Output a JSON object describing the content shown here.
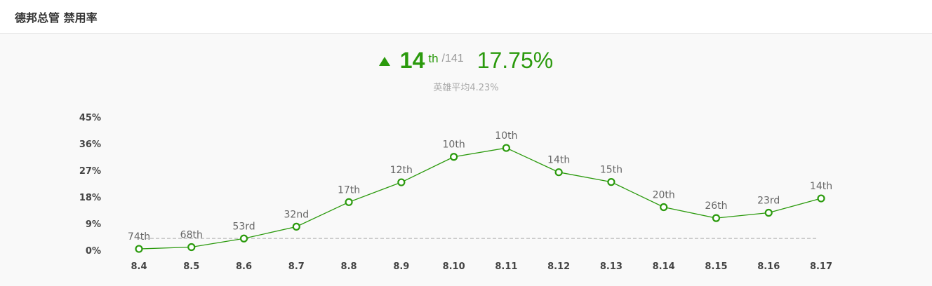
{
  "page": {
    "title": "德邦总管 禁用率"
  },
  "summary": {
    "trend": "up",
    "rank": "14",
    "rank_suffix": "th",
    "rank_total": "/141",
    "rate": "17.75%",
    "average_label": "英雄平均4.23%"
  },
  "colors": {
    "accent": "#2b9a0d",
    "average_line": "#aaaaaa",
    "text": "#444444"
  },
  "icons": {
    "trend_icon": "triangle-up-icon"
  },
  "chart_data": {
    "type": "line",
    "title": "德邦总管 禁用率",
    "xlabel": "",
    "ylabel": "",
    "categories": [
      "8.4",
      "8.5",
      "8.6",
      "8.7",
      "8.8",
      "8.9",
      "8.10",
      "8.11",
      "8.12",
      "8.13",
      "8.14",
      "8.15",
      "8.16",
      "8.17"
    ],
    "ylim": [
      0,
      45
    ],
    "yticks": [
      "0%",
      "9%",
      "18%",
      "27%",
      "36%",
      "45%"
    ],
    "ytick_values": [
      0,
      9,
      18,
      27,
      36,
      45
    ],
    "series": [
      {
        "values": [
          0.7,
          1.3,
          4.2,
          8.2,
          16.5,
          23.2,
          31.8,
          34.8,
          26.6,
          23.3,
          14.8,
          11.1,
          12.9,
          17.75
        ],
        "point_labels": [
          "74th",
          "68th",
          "53rd",
          "32nd",
          "17th",
          "12th",
          "10th",
          "10th",
          "14th",
          "15th",
          "20th",
          "26th",
          "23rd",
          "14th"
        ]
      }
    ],
    "reference_line": {
      "value": 4.23
    },
    "grid": false,
    "legend": "none"
  }
}
